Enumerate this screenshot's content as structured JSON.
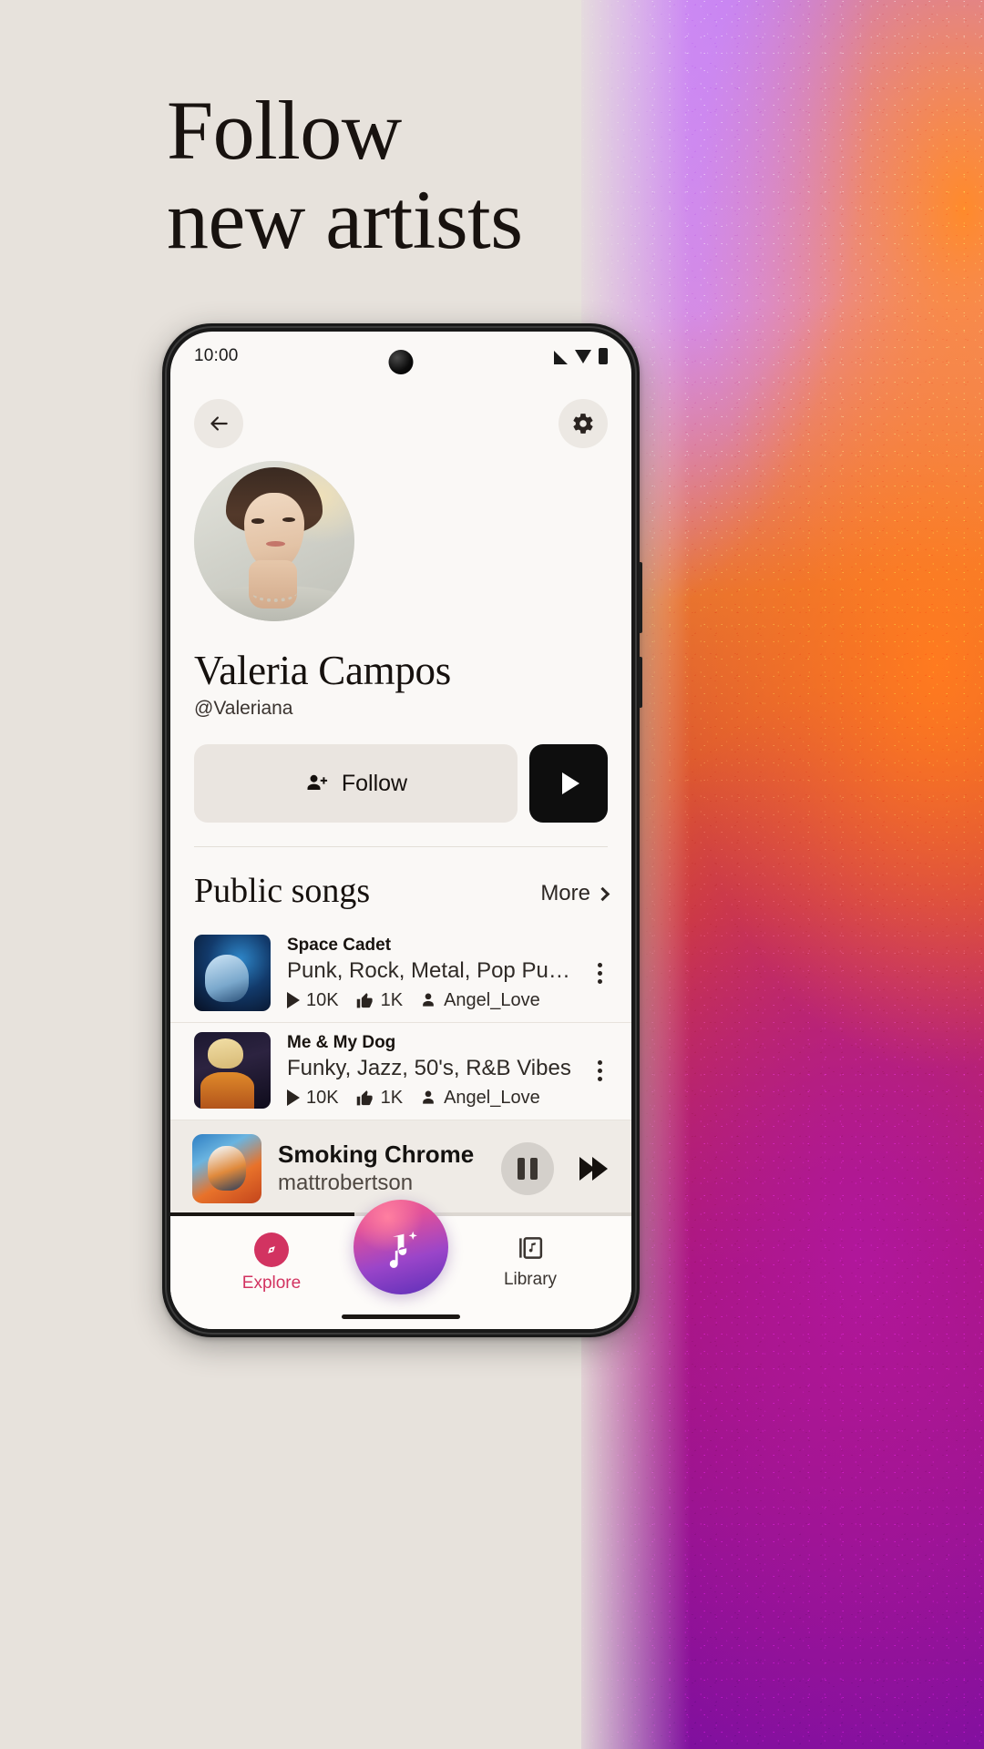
{
  "promo": {
    "headline_line1": "Follow",
    "headline_line2": "new artists"
  },
  "phone": {
    "status_bar": {
      "time": "10:00",
      "icons": [
        "signal-icon",
        "wifi-icon",
        "battery-icon"
      ]
    },
    "header": {
      "back_icon": "back-arrow-icon",
      "settings_icon": "gear-icon"
    },
    "profile": {
      "avatar_alt": "Valeria Campos profile photo",
      "name": "Valeria Campos",
      "handle": "@Valeriana",
      "follow_label": "Follow",
      "follow_icon": "person-add-icon",
      "play_icon": "play-icon"
    },
    "public_songs": {
      "section_title": "Public songs",
      "more_label": "More",
      "more_icon": "chevron-right-icon",
      "items": [
        {
          "title": "Space Cadet",
          "tags": "Punk, Rock, Metal, Pop Punk, Lively, Ex...",
          "plays": "10K",
          "likes": "1K",
          "author": "Angel_Love",
          "menu_icon": "overflow-menu-icon"
        },
        {
          "title": "Me & My Dog",
          "tags": "Funky, Jazz, 50's, R&B Vibes",
          "plays": "10K",
          "likes": "1K",
          "author": "Angel_Love",
          "menu_icon": "overflow-menu-icon"
        }
      ]
    },
    "now_playing": {
      "title": "Smoking Chrome",
      "artist": "mattrobertson",
      "pause_icon": "pause-icon",
      "next_icon": "fast-forward-icon"
    },
    "bottom_nav": {
      "items": [
        {
          "label": "Explore",
          "icon": "compass-icon",
          "color": "#d23361"
        },
        {
          "label": "",
          "icon": "music-note-sparkle-icon",
          "color": "#9a45c9"
        },
        {
          "label": "Library",
          "icon": "library-music-icon",
          "color": "#3a3430"
        }
      ]
    }
  },
  "colors": {
    "page_background": "#e7e2dc",
    "screen_background": "#faf8f6",
    "accent_pink": "#d23361",
    "accent_purple": "#5c2fb8",
    "text_primary": "#16110e"
  }
}
